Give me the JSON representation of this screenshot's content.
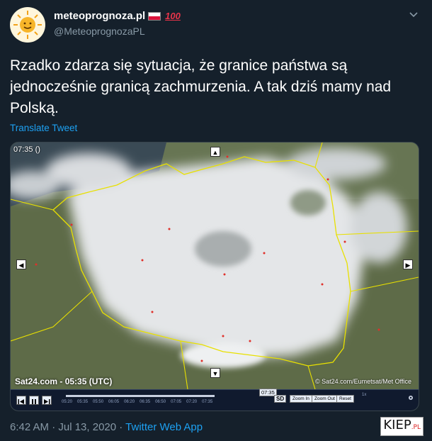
{
  "author": {
    "display_name": "meteoprognoza.pl",
    "handle": "@MeteoprognozaPL",
    "badge_emoji": "100",
    "avatar_icon": "sun-icon"
  },
  "tweet": {
    "text": "Rzadko zdarza się sytuacja, że granice państwa są jednocześnie granicą zachmurzenia. A tak dziś mamy nad Polską.",
    "translate_label": "Translate Tweet"
  },
  "media": {
    "timestamp_top": "07:35 ()",
    "sat_label": "Sat24.com - 05:35 (UTC)",
    "credit": "© Sat24.com/Eumetsat/Met Office",
    "slider_label": "07:35",
    "timeline_ticks": [
      "05:20",
      "05:35",
      "05:50",
      "06:05",
      "06:20",
      "06:35",
      "06:50",
      "07:05",
      "07:20",
      "07:35"
    ],
    "sd_label": "SD",
    "zoom_in_label": "Zoom In",
    "zoom_out_label": "Zoom Out",
    "reset_label": "Reset",
    "speed_label": "1x"
  },
  "footer": {
    "time": "6:42 AM · Jul 13, 2020 · ",
    "app": "Twitter Web App"
  },
  "watermark": {
    "main": "KIEP",
    "suffix": ".PL"
  },
  "colors": {
    "background": "#15202b",
    "link": "#1da1f2",
    "muted": "#8899a6",
    "border_line": "#e8e000"
  }
}
